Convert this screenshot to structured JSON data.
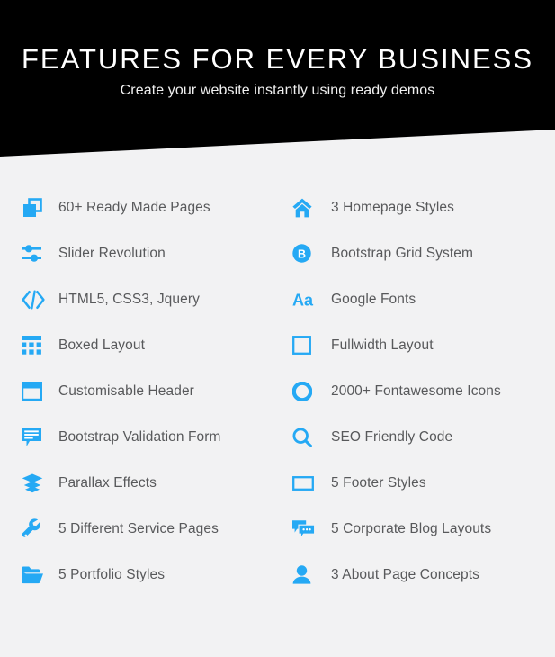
{
  "page": {
    "background_color": "#f2f2f3",
    "accent_color": "#25a9f4",
    "header_background": "#000000",
    "label_color": "#58595b"
  },
  "header": {
    "title": "FEATURES FOR EVERY BUSINESS",
    "subtitle": "Create your website instantly using ready demos"
  },
  "features": {
    "left_column": [
      {
        "icon": "clone-icon",
        "label": "60+ Ready Made Pages"
      },
      {
        "icon": "sliders-icon",
        "label": "Slider Revolution"
      },
      {
        "icon": "code-icon",
        "label": "HTML5, CSS3, Jquery"
      },
      {
        "icon": "grid-table-icon",
        "label": "Boxed Layout"
      },
      {
        "icon": "window-icon",
        "label": "Customisable Header"
      },
      {
        "icon": "comment-lines-icon",
        "label": "Bootstrap Validation Form"
      },
      {
        "icon": "layers-icon",
        "label": "Parallax Effects"
      },
      {
        "icon": "wrench-icon",
        "label": "5 Different Service Pages"
      },
      {
        "icon": "folder-open-icon",
        "label": "5 Portfolio Styles"
      }
    ],
    "right_column": [
      {
        "icon": "home-icon",
        "label": "3 Homepage Styles"
      },
      {
        "icon": "bootstrap-b-icon",
        "label": "Bootstrap Grid System"
      },
      {
        "icon": "font-aa-icon",
        "label": "Google Fonts"
      },
      {
        "icon": "square-outline-icon",
        "label": "Fullwidth Layout"
      },
      {
        "icon": "circle-ring-icon",
        "label": "2000+ Fontawesome Icons"
      },
      {
        "icon": "search-icon",
        "label": "SEO Friendly Code"
      },
      {
        "icon": "rectangle-icon",
        "label": "5 Footer Styles"
      },
      {
        "icon": "comments-icon",
        "label": "5 Corporate Blog Layouts"
      },
      {
        "icon": "user-icon",
        "label": "3 About Page Concepts"
      }
    ]
  }
}
